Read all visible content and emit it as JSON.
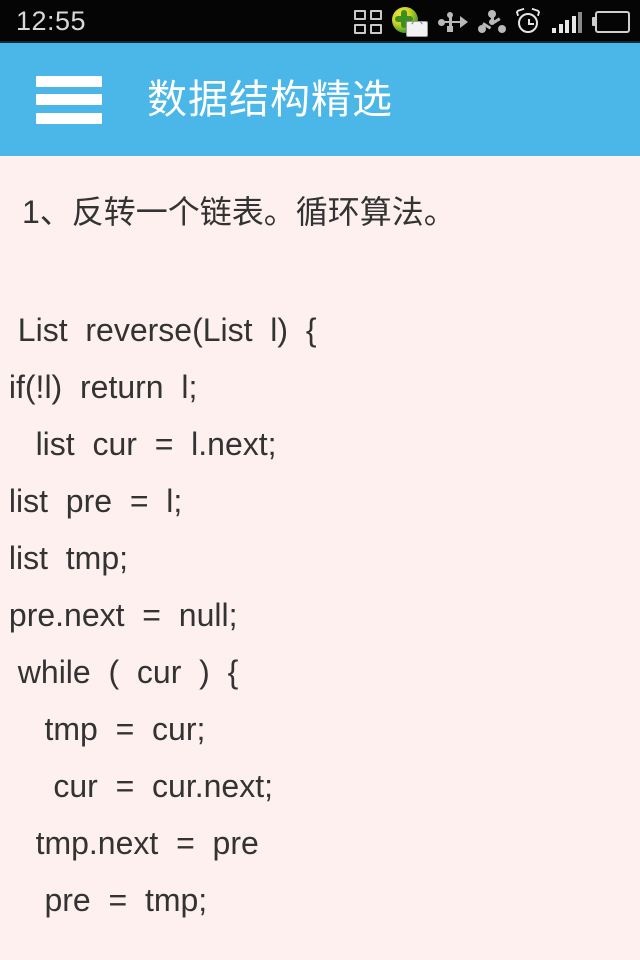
{
  "status_bar": {
    "clock": "12:55",
    "icons": [
      {
        "name": "app-grid-icon"
      },
      {
        "name": "mail-globe-icon"
      },
      {
        "name": "usb-icon"
      },
      {
        "name": "share-nodes-icon"
      },
      {
        "name": "alarm-clock-icon"
      },
      {
        "name": "signal-bars-icon"
      },
      {
        "name": "battery-icon"
      }
    ],
    "background": "#050505",
    "text_color": "#d8d8d8"
  },
  "app_header": {
    "title": "数据结构精选",
    "menu_icon": "hamburger-icon",
    "background": "#4bb6e8",
    "text_color": "#ffffff"
  },
  "content": {
    "background": "#fdf0ee",
    "text_color": "#333333",
    "question": "1、反转一个链表。循环算法。",
    "code_lines": [
      "  List  reverse(List  l)  {",
      " if(!l)  return  l;",
      "    list  cur  =  l.next;",
      " list  pre  =  l;",
      " list  tmp;",
      " pre.next  =  null;",
      "  while  (  cur  )  {",
      "     tmp  =  cur;",
      "      cur  =  cur.next;",
      "    tmp.next  =  pre",
      "     pre  =  tmp;"
    ]
  }
}
